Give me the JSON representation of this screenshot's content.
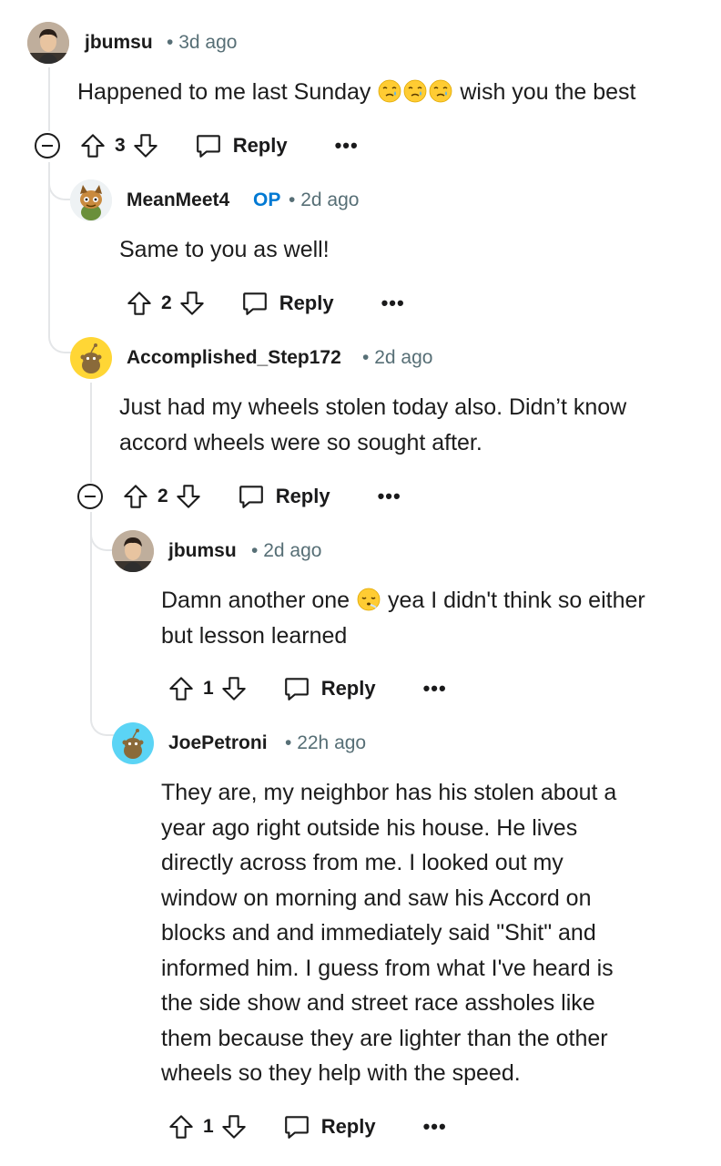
{
  "comments": [
    {
      "username": "jbumsu",
      "is_op": false,
      "time": "3d ago",
      "body_before": "Happened to me last Sunday",
      "body_emojis": [
        "holding-back-tears-emoji",
        "holding-back-tears-emoji",
        "holding-back-tears-emoji"
      ],
      "body_after": "wish you the best",
      "score": "3",
      "reply_label": "Reply",
      "more_label": "•••",
      "avatar": "user-photo-avatar",
      "collapsible": true
    },
    {
      "username": "MeanMeet4",
      "is_op": true,
      "op_label": "OP",
      "time": "2d ago",
      "body": "Same to you as well!",
      "score": "2",
      "reply_label": "Reply",
      "more_label": "•••",
      "avatar": "snoo-avatar-costume"
    },
    {
      "username": "Accomplished_Step172",
      "is_op": false,
      "time": "2d ago",
      "body_lines": [
        "Just had my wheels stolen today also. Didn’t know",
        "accord wheels were so sought after."
      ],
      "score": "2",
      "reply_label": "Reply",
      "more_label": "•••",
      "avatar": "default-snoo-avatar-yellow",
      "collapsible": true
    },
    {
      "username": "jbumsu",
      "is_op": false,
      "time": "2d ago",
      "body_line1_before": "Damn another one",
      "body_emoji": "face-exhaling-emoji",
      "body_line1_after": "yea I didn't think so either",
      "body_line2": "but lesson learned",
      "score": "1",
      "reply_label": "Reply",
      "more_label": "•••",
      "avatar": "user-photo-avatar"
    },
    {
      "username": "JoePetroni",
      "is_op": false,
      "time": "22h ago",
      "body_lines": [
        "They are, my neighbor has his stolen about a",
        "year ago right outside his house. He lives",
        "directly across from me. I looked out my",
        "window on morning and saw his Accord on",
        "blocks and and immediately said \"Shit\" and",
        "informed him. I guess from what I've heard is",
        "the side show and street race assholes like",
        "them because they are lighter than the other",
        "wheels so they help with the speed."
      ],
      "score": "1",
      "reply_label": "Reply",
      "more_label": "•••",
      "avatar": "default-snoo-avatar-blue"
    }
  ],
  "separator": "•",
  "colors": {
    "op_blue": "#0079d3",
    "meta_gray": "#576f76",
    "thread_line": "#e4e6e8",
    "snoo_yellow": "#ffd635",
    "snoo_blue": "#5bd4f5"
  }
}
